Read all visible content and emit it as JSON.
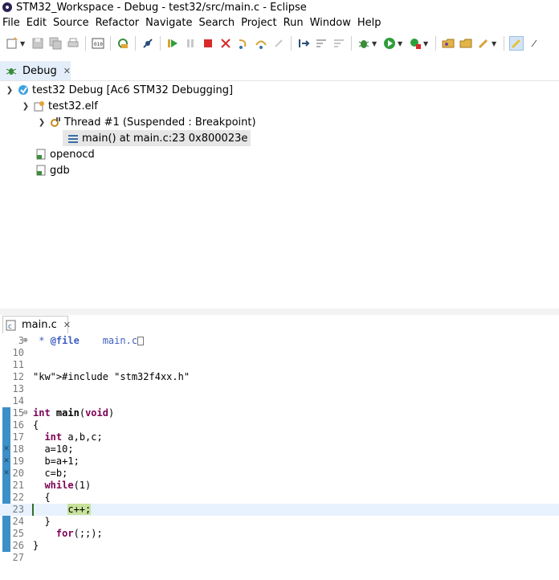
{
  "window": {
    "title": "STM32_Workspace - Debug - test32/src/main.c - Eclipse"
  },
  "menu": [
    "File",
    "Edit",
    "Source",
    "Refactor",
    "Navigate",
    "Search",
    "Project",
    "Run",
    "Window",
    "Help"
  ],
  "debug_view": {
    "tab_label": "Debug",
    "tree": {
      "launch": "test32 Debug [Ac6 STM32 Debugging]",
      "process": "test32.elf",
      "thread": "Thread #1 (Suspended : Breakpoint)",
      "frame": "main() at main.c:23 0x800023e",
      "others": [
        "openocd",
        "gdb"
      ]
    }
  },
  "editor": {
    "tab_label": "main.c",
    "lines": [
      {
        "no": "3",
        "fold": "+",
        "text": " * @file    main.c"
      },
      {
        "no": "10",
        "text": ""
      },
      {
        "no": "11",
        "text": ""
      },
      {
        "no": "12",
        "text": "#include \"stm32f4xx.h\""
      },
      {
        "no": "13",
        "text": ""
      },
      {
        "no": "14",
        "text": ""
      },
      {
        "no": "15",
        "fold": "−",
        "text": "int main(void)"
      },
      {
        "no": "16",
        "text": "{"
      },
      {
        "no": "17",
        "text": "  int a,b,c;"
      },
      {
        "no": "18",
        "text": "  a=10;"
      },
      {
        "no": "19",
        "text": "  b=a+1;"
      },
      {
        "no": "20",
        "text": "  c=b;"
      },
      {
        "no": "21",
        "text": "  while(1)"
      },
      {
        "no": "22",
        "text": "  {"
      },
      {
        "no": "23",
        "text": "      c++;"
      },
      {
        "no": "24",
        "text": "  }"
      },
      {
        "no": "25",
        "text": "    for(;;);"
      },
      {
        "no": "26",
        "text": "}"
      },
      {
        "no": "27",
        "text": ""
      }
    ]
  }
}
